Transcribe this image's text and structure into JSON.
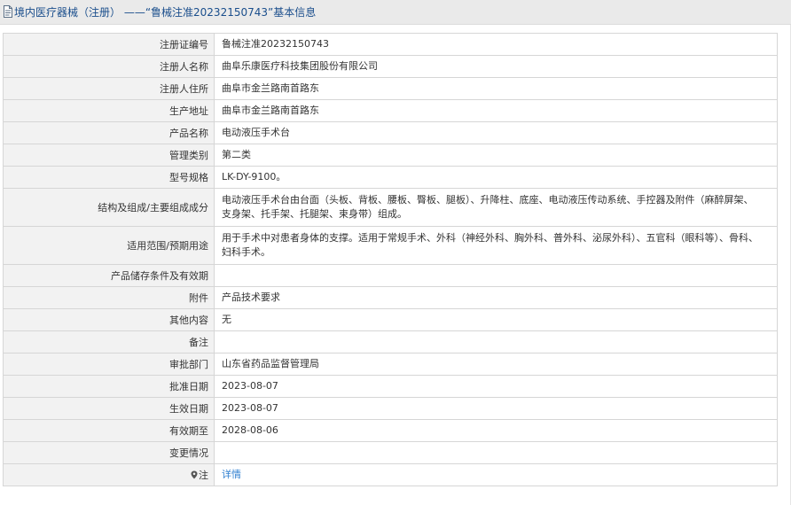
{
  "header": {
    "title": "境内医疗器械（注册） ——“鲁械注准20232150743”基本信息"
  },
  "icons": {
    "doc_icon": "document-icon",
    "pin_icon": "map-pin-icon"
  },
  "colors": {
    "title_text": "#1a4e8c",
    "label_bg": "#f2f2f2",
    "link": "#2f7fd0",
    "header_bg": "#eaeaea"
  },
  "rows": [
    {
      "label": "注册证编号",
      "value": "鲁械注准20232150743"
    },
    {
      "label": "注册人名称",
      "value": "曲阜乐康医疗科技集团股份有限公司"
    },
    {
      "label": "注册人住所",
      "value": "曲阜市金兰路南首路东"
    },
    {
      "label": "生产地址",
      "value": "曲阜市金兰路南首路东"
    },
    {
      "label": "产品名称",
      "value": "电动液压手术台"
    },
    {
      "label": "管理类别",
      "value": "第二类"
    },
    {
      "label": "型号规格",
      "value": "LK-DY-9100。"
    },
    {
      "label": "结构及组成/主要组成成分",
      "value": "电动液压手术台由台面（头板、背板、腰板、臀板、腿板）、升降柱、底座、电动液压传动系统、手控器及附件（麻醉屏架、支身架、托手架、托腿架、束身带）组成。"
    },
    {
      "label": "适用范围/预期用途",
      "value": "用于手术中对患者身体的支撑。适用于常规手术、外科（神经外科、胸外科、普外科、泌尿外科）、五官科（眼科等）、骨科、妇科手术。"
    },
    {
      "label": "产品储存条件及有效期",
      "value": ""
    },
    {
      "label": "附件",
      "value": "产品技术要求"
    },
    {
      "label": "其他内容",
      "value": "无"
    },
    {
      "label": "备注",
      "value": ""
    },
    {
      "label": "审批部门",
      "value": "山东省药品监督管理局"
    },
    {
      "label": "批准日期",
      "value": "2023-08-07"
    },
    {
      "label": "生效日期",
      "value": "2023-08-07"
    },
    {
      "label": "有效期至",
      "value": "2028-08-06"
    },
    {
      "label": "变更情况",
      "value": ""
    }
  ],
  "note": {
    "label": "注",
    "link_text": "详情"
  }
}
